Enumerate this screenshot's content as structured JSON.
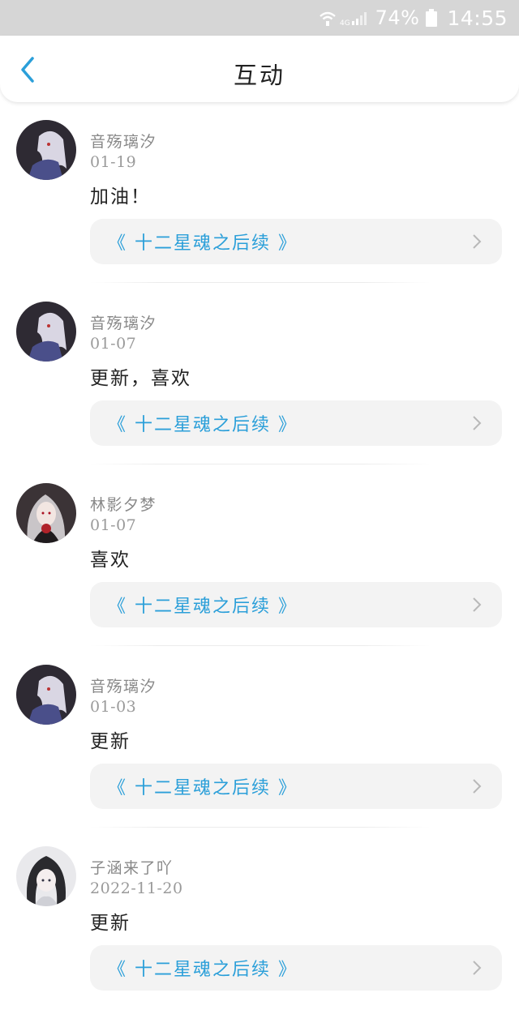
{
  "status_bar": {
    "network": "4G",
    "battery": "74%",
    "time": "14:55"
  },
  "header": {
    "title": "互动"
  },
  "colors": {
    "accent": "#2b9fd9",
    "status_bar_bg": "#d6d6d6",
    "card_bg": "#f3f3f3"
  },
  "items": [
    {
      "user": "音殇璃汐",
      "date": "01-19",
      "comment": "加油！",
      "book": "《 十二星魂之后续 》",
      "avatar": "avatar-white-hair"
    },
    {
      "user": "音殇璃汐",
      "date": "01-07",
      "comment": "更新，喜欢",
      "book": "《 十二星魂之后续 》",
      "avatar": "avatar-white-hair"
    },
    {
      "user": "林影夕梦",
      "date": "01-07",
      "comment": "喜欢",
      "book": "《 十二星魂之后续 》",
      "avatar": "avatar-rose-girl"
    },
    {
      "user": "音殇璃汐",
      "date": "01-03",
      "comment": "更新",
      "book": "《 十二星魂之后续 》",
      "avatar": "avatar-white-hair"
    },
    {
      "user": "子涵来了吖",
      "date": "2022-11-20",
      "comment": "更新",
      "book": "《 十二星魂之后续 》",
      "avatar": "avatar-dark-hair"
    }
  ]
}
